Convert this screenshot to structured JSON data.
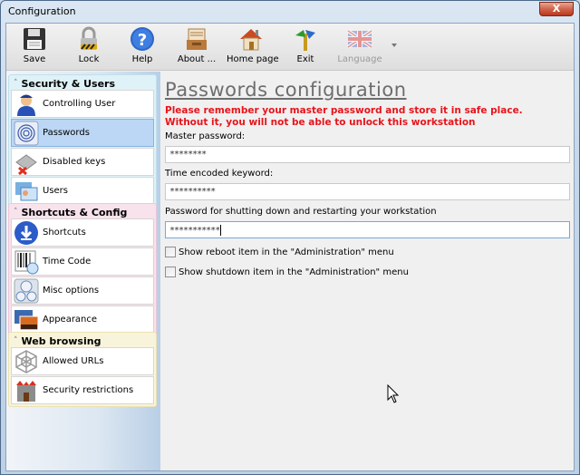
{
  "window": {
    "title": "Configuration",
    "close_label": "X"
  },
  "toolbar": {
    "buttons": [
      {
        "id": "save",
        "label": "Save",
        "icon": "floppy-disk-icon"
      },
      {
        "id": "lock",
        "label": "Lock",
        "icon": "padlock-icon"
      },
      {
        "id": "help",
        "label": "Help",
        "icon": "help-icon"
      },
      {
        "id": "about",
        "label": "About ...",
        "icon": "inbox-tray-icon"
      },
      {
        "id": "home",
        "label": "Home page",
        "icon": "house-icon"
      },
      {
        "id": "exit",
        "label": "Exit",
        "icon": "signpost-icon"
      },
      {
        "id": "language",
        "label": "Language",
        "icon": "uk-flag-icon",
        "disabled": true
      }
    ]
  },
  "sidebar": {
    "groups": [
      {
        "title": "Security & Users",
        "items": [
          {
            "label": "Controlling User",
            "icon": "policeman-icon"
          },
          {
            "label": "Passwords",
            "icon": "fingerprint-icon",
            "active": true
          },
          {
            "label": "Disabled keys",
            "icon": "disabled-key-icon"
          },
          {
            "label": "Users",
            "icon": "user-cards-icon"
          }
        ]
      },
      {
        "title": "Shortcuts & Config",
        "items": [
          {
            "label": "Shortcuts",
            "icon": "shortcut-arrow-icon"
          },
          {
            "label": "Time Code",
            "icon": "barcode-clock-icon"
          },
          {
            "label": "Misc options",
            "icon": "gauges-icon"
          },
          {
            "label": "Appearance",
            "icon": "pictures-icon"
          }
        ]
      },
      {
        "title": "Web browsing",
        "items": [
          {
            "label": "Allowed URLs",
            "icon": "spiderweb-icon"
          },
          {
            "label": "Security restrictions",
            "icon": "castle-icon"
          }
        ]
      }
    ]
  },
  "main": {
    "title": "Passwords configuration",
    "warning": "Please remember your master password and store it in safe place. Without it, you will not be able to unlock this workstation",
    "fields": [
      {
        "label": "Master password:",
        "value": "********"
      },
      {
        "label": "Time encoded keyword:",
        "value": "**********"
      },
      {
        "label": "Password for shutting down and restarting your workstation",
        "value": "***********"
      }
    ],
    "checkboxes": [
      {
        "label": "Show reboot item in the \"Administration\" menu",
        "checked": false
      },
      {
        "label": "Show shutdown item in the \"Administration\" menu",
        "checked": false
      }
    ]
  },
  "colors": {
    "warning": "#e8141b",
    "active_item": "#bcd7f5"
  }
}
